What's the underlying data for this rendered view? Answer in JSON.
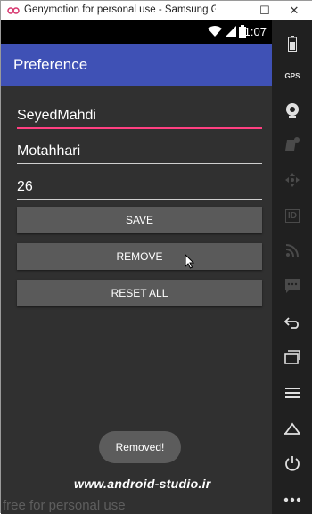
{
  "window": {
    "title": "Genymotion for personal use - Samsung Galaxy S...",
    "minimize_symbol": "—",
    "maximize_symbol": "☐",
    "close_symbol": "✕"
  },
  "statusbar": {
    "time": "1:07"
  },
  "app": {
    "title": "Preference"
  },
  "fields": {
    "first_name": "SeyedMahdi",
    "last_name": "Motahhari",
    "age": "26"
  },
  "buttons": {
    "save": "SAVE",
    "remove": "REMOVE",
    "reset_all": "RESET ALL"
  },
  "toast": {
    "message": "Removed!"
  },
  "watermarks": {
    "site": "www.android-studio.ir",
    "free": "free for personal use"
  },
  "sidebar": {
    "gps_label": "GPS",
    "id_label": "ID",
    "items": [
      "battery-icon",
      "gps-icon",
      "camera-icon",
      "video-icon",
      "move-icon",
      "id-icon",
      "rss-icon",
      "chat-icon",
      "back-icon",
      "recent-apps-icon",
      "menu-icon",
      "home-icon",
      "power-icon",
      "more-icon"
    ]
  },
  "colors": {
    "appbar": "#3f51b5",
    "accent": "#ff4081",
    "background": "#303030",
    "button": "#5a5a5a"
  }
}
